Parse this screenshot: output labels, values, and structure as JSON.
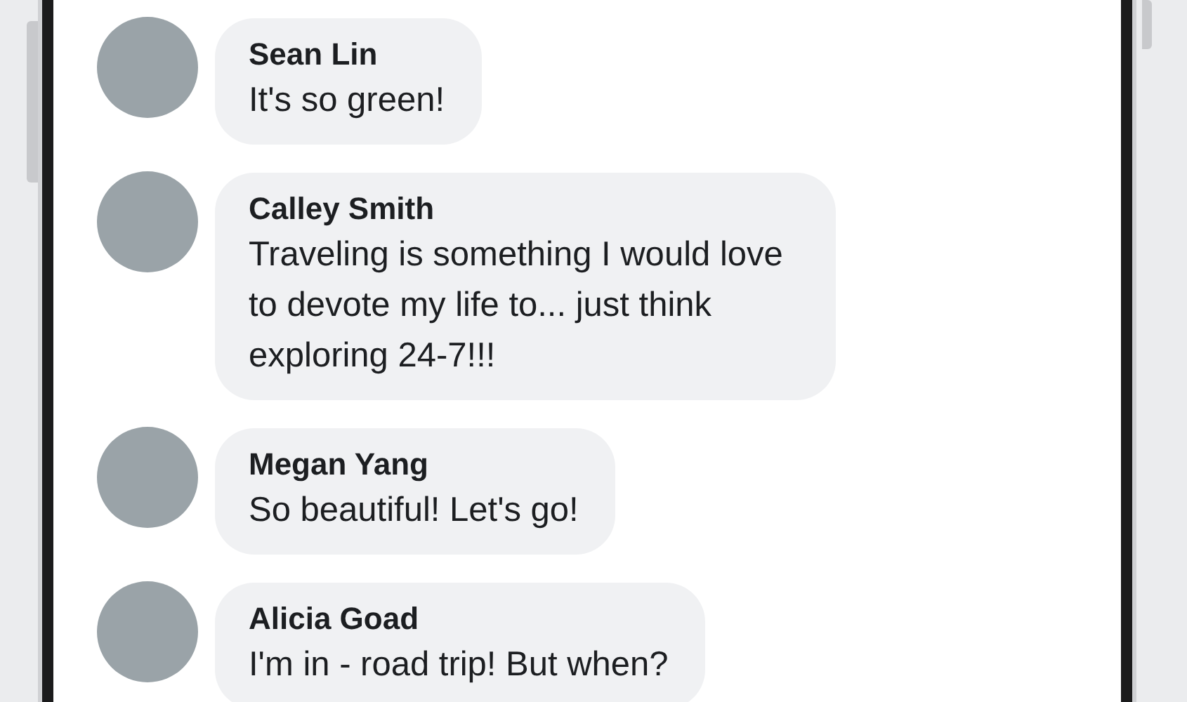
{
  "comments": [
    {
      "author": "Sean Lin",
      "text": "It's so green!"
    },
    {
      "author": "Calley Smith",
      "text": "Traveling is something I would love to devote my life to... just think exploring 24-7!!!"
    },
    {
      "author": "Megan Yang",
      "text": "So beautiful! Let's go!"
    },
    {
      "author": "Alicia Goad",
      "text": "I'm in - road trip! But when?"
    }
  ]
}
